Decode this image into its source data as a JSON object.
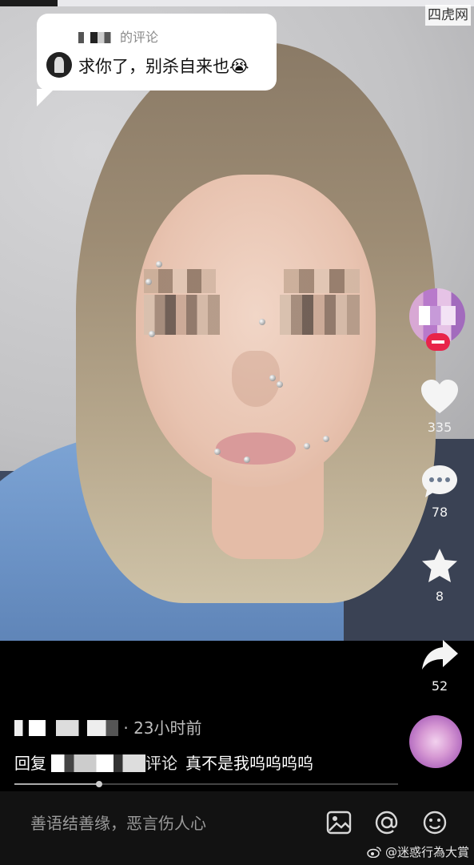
{
  "site_watermark": "四虎网",
  "comment_bubble": {
    "title_suffix": "的评论",
    "text": "求你了，别杀自来也😭"
  },
  "rail": {
    "likes": "335",
    "comments": "78",
    "favorites": "8",
    "shares": "52"
  },
  "caption": {
    "time": "· 23小时前",
    "reply_prefix": "回复",
    "reply_mention_suffix": "评论",
    "reply_text": "真不是我呜呜呜呜"
  },
  "progress": {
    "fraction": 0.22
  },
  "input": {
    "placeholder": "善语结善缘，恶言伤人心"
  },
  "bottom_watermark": "@迷惑行為大賞",
  "icons": [
    "heart-icon",
    "comment-icon",
    "star-icon",
    "share-icon",
    "image-icon",
    "at-icon",
    "emoji-icon",
    "weibo-icon"
  ]
}
